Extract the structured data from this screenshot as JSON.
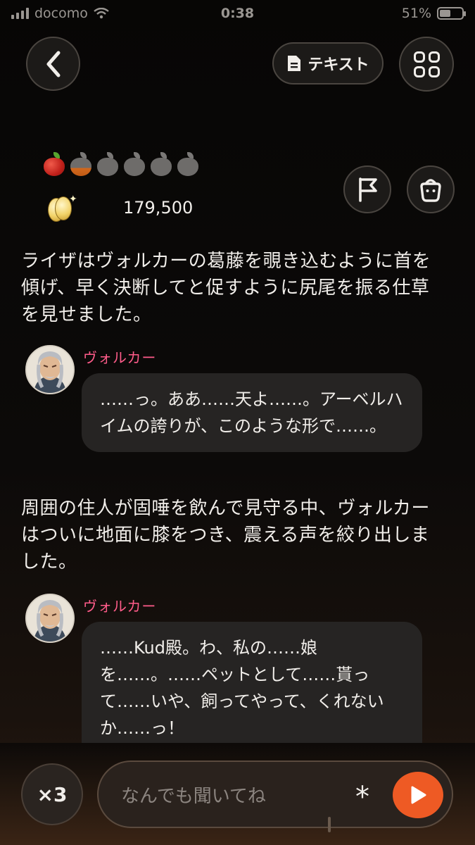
{
  "status_bar": {
    "carrier": "docomo",
    "time": "0:38",
    "battery_percent": "51%",
    "battery_level": 0.51
  },
  "nav": {
    "text_button_label": "テキスト",
    "icons": [
      "chevron-left-icon",
      "document-icon",
      "grid-menu-icon",
      "flag-icon",
      "bag-icon"
    ]
  },
  "stats": {
    "apples_filled": 1,
    "apples_partial": 1,
    "apples_total": 6,
    "coins": "179,500"
  },
  "story": {
    "narration_1": "ライザはヴォルカーの葛藤を覗き込むように首を傾げ、早く決断してと促すように尻尾を振る仕草を見せました。",
    "dialogue_1": {
      "speaker": "ヴォルカー",
      "text": "……っ。ああ……天よ……。アーベルハイムの誇りが、このような形で……。"
    },
    "narration_2": "周囲の住人が固唾を飲んで見守る中、ヴォルカーはついに地面に膝をつき、震える声を絞り出しました。",
    "dialogue_2": {
      "speaker": "ヴォルカー",
      "text": "……Kud殿。わ、私の……娘を……。……ペットとして……貰って……いや、飼ってやって、くれないか……っ！"
    }
  },
  "composer": {
    "speed_label": "×3",
    "placeholder": "なんでも聞いてね",
    "asterisk_label": "*"
  },
  "colors": {
    "accent": "#ee5a24",
    "speaker": "#ff5c8a",
    "bubble": "#262423"
  }
}
